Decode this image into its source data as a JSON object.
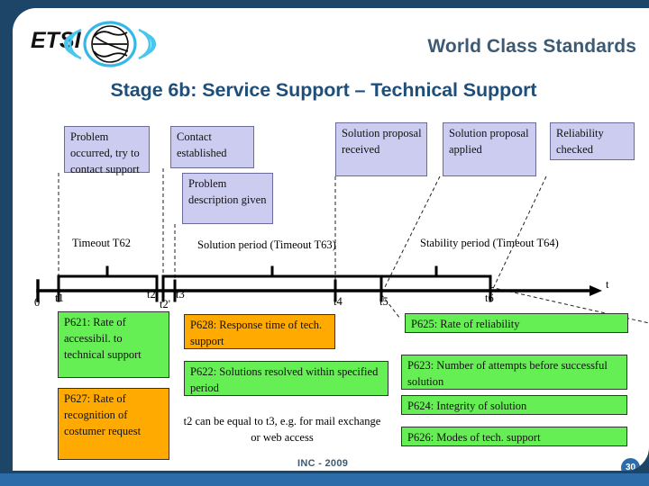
{
  "header": {
    "logo_text": "ETSI",
    "logo_name": "etsi-logo",
    "tagline": "World Class Standards",
    "title": "Stage 6b: Service Support – Technical Support"
  },
  "state_boxes": [
    {
      "id": "problem-occurred",
      "text": "Problem occurred, try to contact support",
      "color": "#ccccf0"
    },
    {
      "id": "contact-established",
      "text": "Contact established",
      "color": "#ccccf0"
    },
    {
      "id": "problem-description",
      "text": "Problem description given",
      "color": "#ccccf0"
    },
    {
      "id": "solution-received",
      "text": "Solution proposal received",
      "color": "#ccccf0"
    },
    {
      "id": "solution-applied",
      "text": "Solution proposal applied",
      "color": "#ccccf0"
    },
    {
      "id": "reliability-checked",
      "text": "Reliability checked",
      "color": "#ccccf0"
    }
  ],
  "periods": [
    {
      "id": "t62",
      "label": "Timeout T62"
    },
    {
      "id": "t63",
      "label": "Solution period (Timeout T63)"
    },
    {
      "id": "t64",
      "label": "Stability period (Timeout T64)"
    }
  ],
  "axis": {
    "origin_label": "0",
    "arrow_label": "t",
    "ticks": [
      "t1",
      "t2",
      "t2'",
      "t3",
      "t4",
      "t5",
      "t6"
    ]
  },
  "parameter_boxes": [
    {
      "id": "p621",
      "text": "P621: Rate of accessibil. to technical support",
      "color": "#66ee55"
    },
    {
      "id": "p627",
      "text": "P627: Rate of recognition of costumer request",
      "color": "#ffaa00"
    },
    {
      "id": "p628",
      "text": "P628: Response time of tech. support",
      "color": "#ffaa00"
    },
    {
      "id": "p622",
      "text": "P622: Solutions resolved within specified period",
      "color": "#66ee55"
    },
    {
      "id": "p625",
      "text": "P625: Rate of reliability",
      "color": "#66ee55"
    },
    {
      "id": "p623",
      "text": "P623: Number of attempts before successful solution",
      "color": "#66ee55"
    },
    {
      "id": "p624",
      "text": "P624: Integrity of solution",
      "color": "#66ee55"
    },
    {
      "id": "p626",
      "text": "P626: Modes of tech. support",
      "color": "#66ee55"
    }
  ],
  "note": "t2 can be equal to t3, e.g. for mail exchange or web access",
  "footer": {
    "source": "INC - 2009",
    "page": "30"
  },
  "colors": {
    "frame": "#1d4568",
    "accent": "#2c6ca8",
    "title": "#1f4e79",
    "lavender": "#ccccf0",
    "green": "#66ee55",
    "orange": "#ffaa00"
  }
}
